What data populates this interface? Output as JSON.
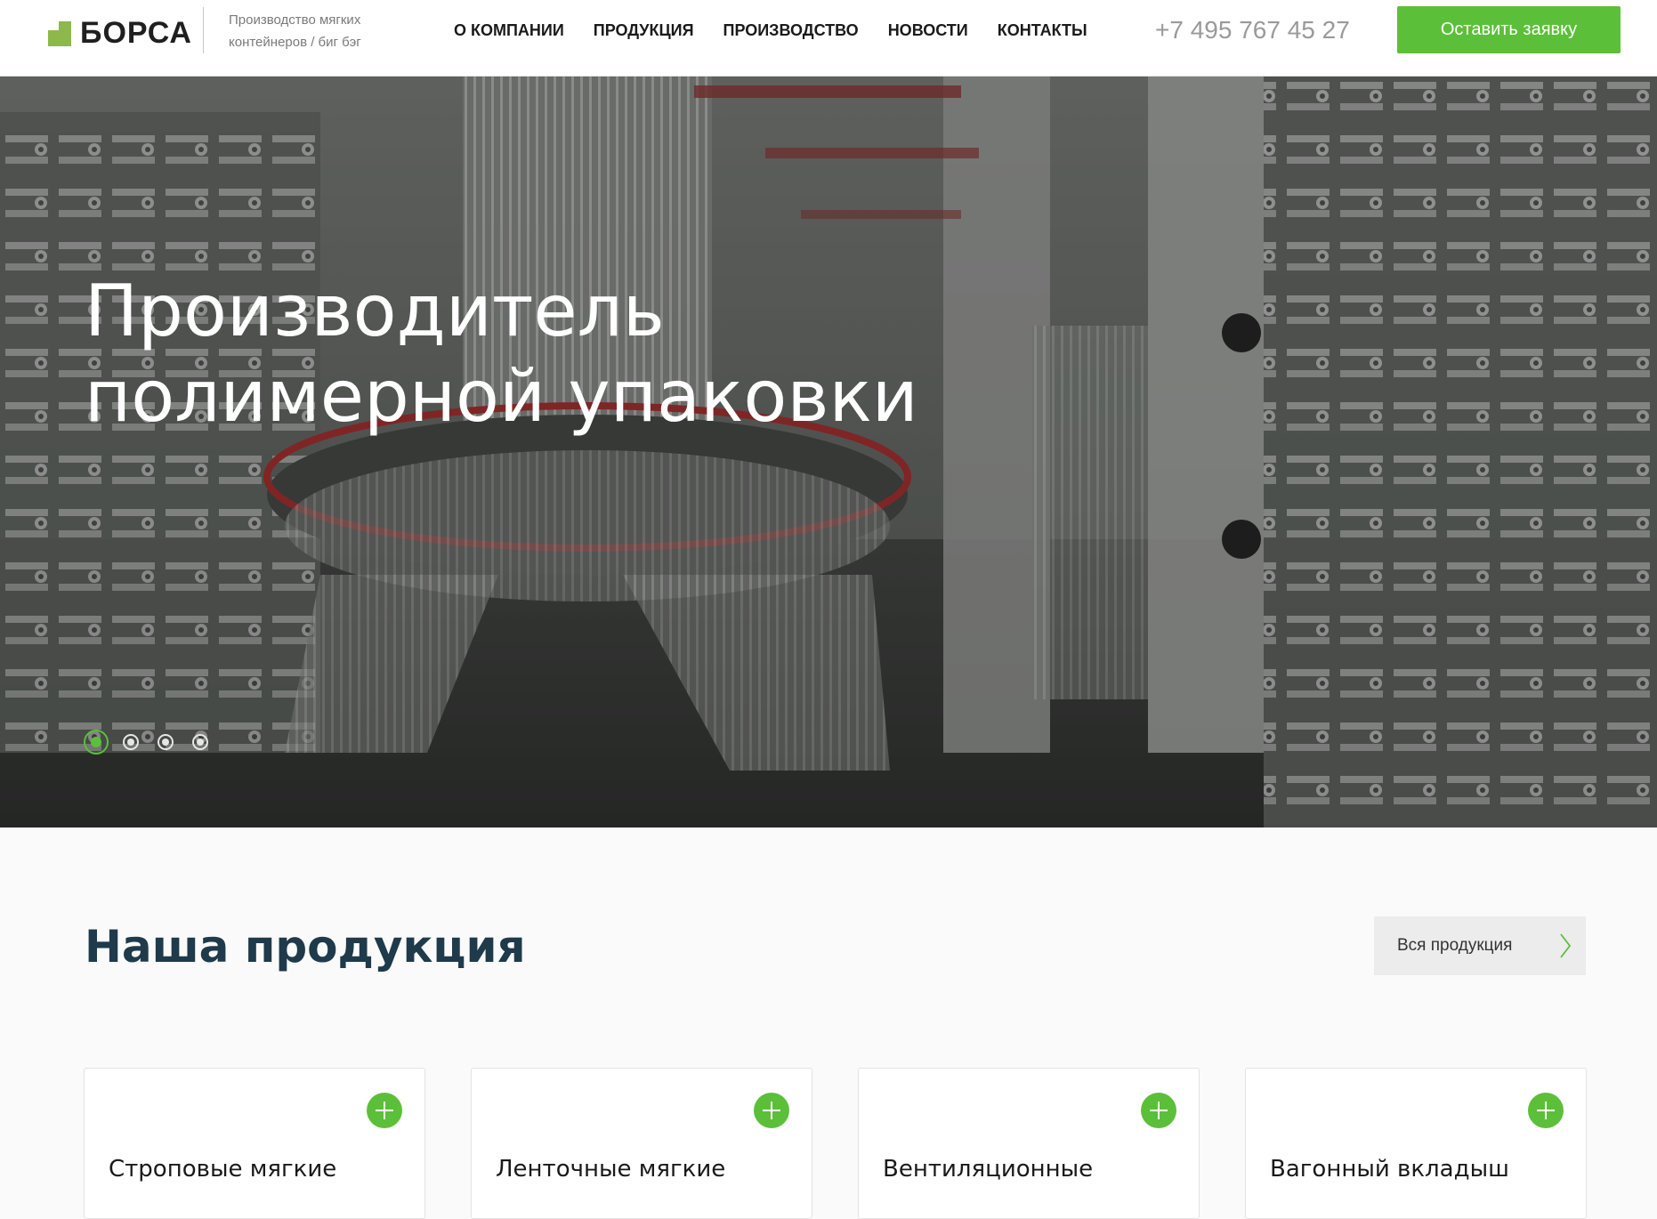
{
  "logo": {
    "text": "БОРСА"
  },
  "tagline": {
    "line1": "Производство мягких",
    "line2": "контейнеров / биг бэг"
  },
  "nav": {
    "items": [
      {
        "label": "О КОМПАНИИ"
      },
      {
        "label": "ПРОДУКЦИЯ"
      },
      {
        "label": "ПРОИЗВОДСТВО"
      },
      {
        "label": "НОВОСТИ"
      },
      {
        "label": "КОНТАКТЫ"
      }
    ]
  },
  "header": {
    "phone": "+7 495 767 45 27",
    "cta_label": "Оставить заявку"
  },
  "hero": {
    "title_line1": "Производитель",
    "title_line2": "полимерной упаковки",
    "slide_count": 4,
    "active_slide": 1
  },
  "products": {
    "title": "Наша продукция",
    "all_label": "Вся продукция",
    "items": [
      {
        "title": "Строповые мягкие"
      },
      {
        "title": "Ленточные мягкие"
      },
      {
        "title": "Вентиляционные"
      },
      {
        "title": "Вагонный вкладыш"
      }
    ]
  },
  "colors": {
    "accent": "#5cbf3a",
    "logo": "#8db84a",
    "heading": "#1f3a4a"
  },
  "icons": {
    "plus": "plus-icon",
    "chevron": "chevron-right-icon"
  }
}
